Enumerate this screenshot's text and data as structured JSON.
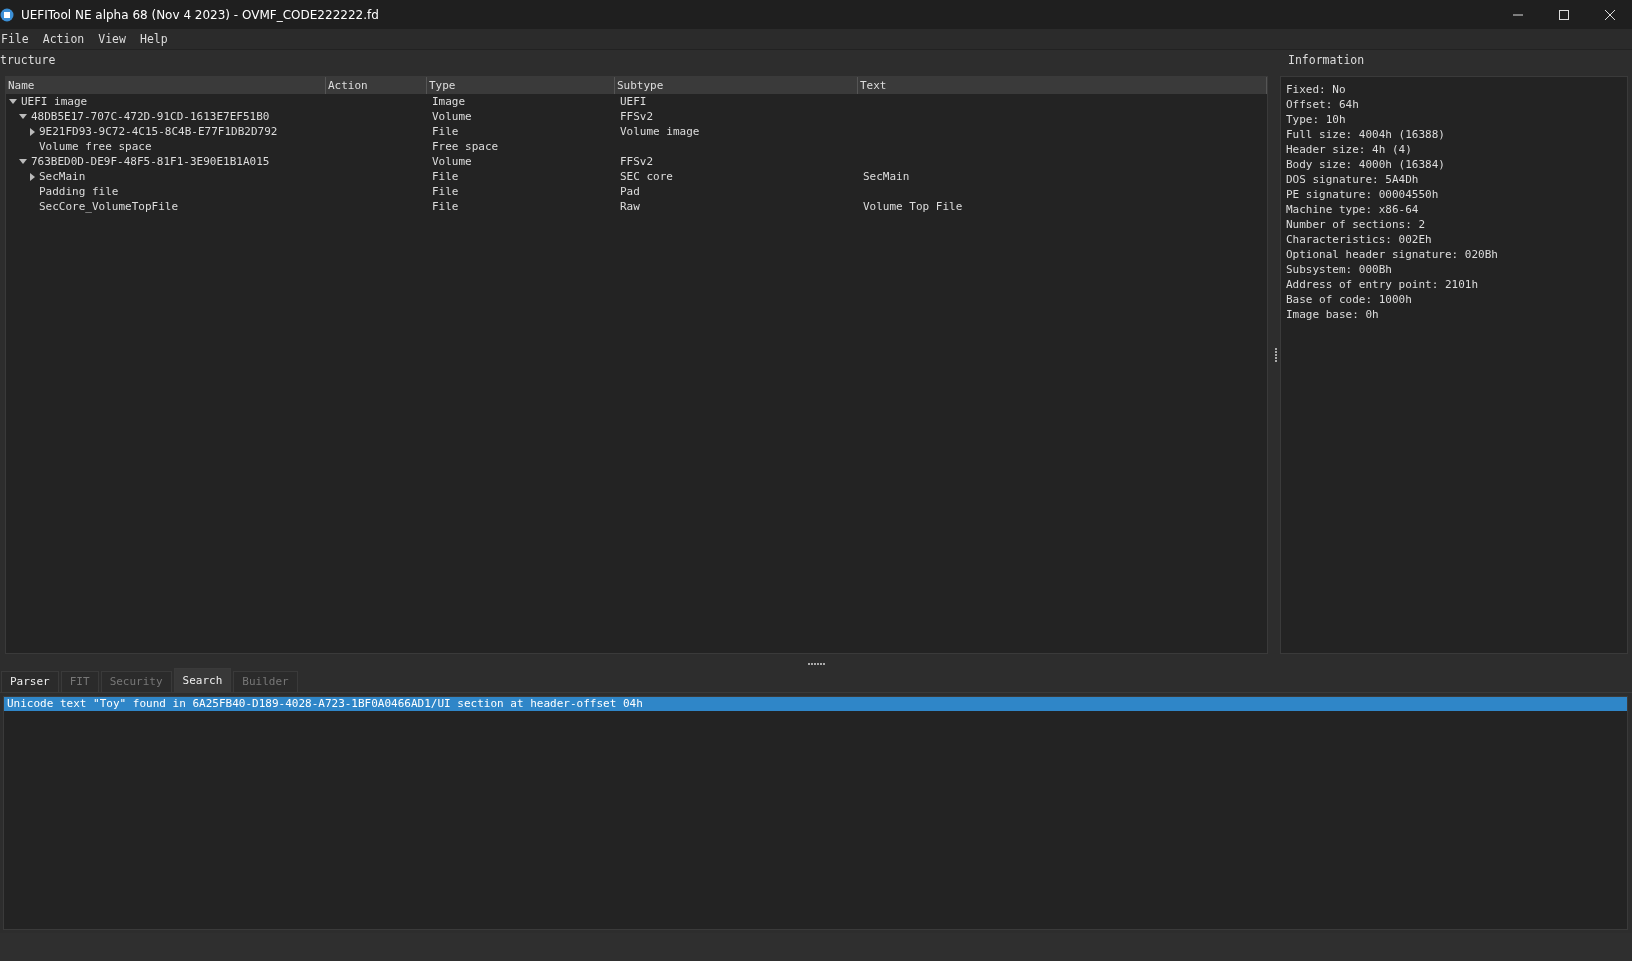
{
  "window": {
    "title": "UEFITool NE alpha 68 (Nov  4 2023) - OVMF_CODE222222.fd"
  },
  "menu": [
    "File",
    "Action",
    "View",
    "Help"
  ],
  "structure": {
    "title": "tructure",
    "columns": [
      "Name",
      "Action",
      "Type",
      "Subtype",
      "Text"
    ],
    "tree": [
      {
        "name": "UEFI image",
        "type": "Image",
        "subtype": "UEFI",
        "expanded": true,
        "children": [
          {
            "name": "48DB5E17-707C-472D-91CD-1613E7EF51B0",
            "type": "Volume",
            "subtype": "FFSv2",
            "expanded": true,
            "children": [
              {
                "name": "9E21FD93-9C72-4C15-8C4B-E77F1DB2D792",
                "type": "File",
                "subtype": "Volume image",
                "expanded": false
              },
              {
                "name": "Volume free space",
                "type": "Free space"
              }
            ]
          },
          {
            "name": "763BED0D-DE9F-48F5-81F1-3E90E1B1A015",
            "type": "Volume",
            "subtype": "FFSv2",
            "expanded": true,
            "children": [
              {
                "name": "SecMain",
                "type": "File",
                "subtype": "SEC core",
                "text": "SecMain",
                "expanded": false
              },
              {
                "name": "Padding file",
                "type": "File",
                "subtype": "Pad"
              },
              {
                "name": "SecCore_VolumeTopFile",
                "type": "File",
                "subtype": "Raw",
                "text": "Volume Top File"
              }
            ]
          }
        ]
      }
    ]
  },
  "information": {
    "title": "Information",
    "lines": [
      "Fixed: No",
      "Offset: 64h",
      "Type: 10h",
      "Full size: 4004h (16388)",
      "Header size: 4h (4)",
      "Body size: 4000h (16384)",
      "DOS signature: 5A4Dh",
      "PE signature: 00004550h",
      "Machine type: x86-64",
      "Number of sections: 2",
      "Characteristics: 002Eh",
      "Optional header signature: 020Bh",
      "Subsystem: 000Bh",
      "Address of entry point: 2101h",
      "Base of code: 1000h",
      "Image base: 0h"
    ]
  },
  "tabs": [
    {
      "label": "Parser",
      "selected": false,
      "disabled": false
    },
    {
      "label": "FIT",
      "selected": false,
      "disabled": true
    },
    {
      "label": "Security",
      "selected": false,
      "disabled": true
    },
    {
      "label": "Search",
      "selected": true,
      "disabled": false
    },
    {
      "label": "Builder",
      "selected": false,
      "disabled": true
    }
  ],
  "messages": [
    {
      "text": "Unicode text \"Toy\" found in 6A25FB40-D189-4028-A723-1BF0A0466AD1/UI section at header-offset 04h",
      "selected": true
    }
  ]
}
